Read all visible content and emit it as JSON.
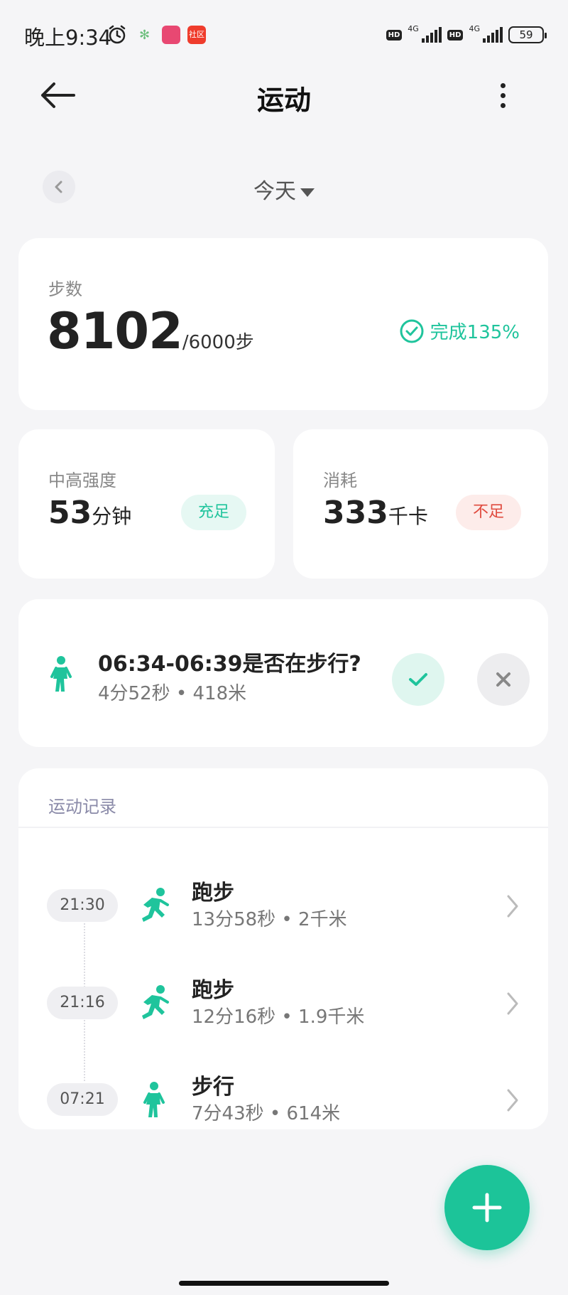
{
  "status_bar": {
    "time": "晚上9:34",
    "app3_label": "社区",
    "hd": "HD",
    "network": "4G",
    "battery": "59"
  },
  "header": {
    "title": "运动"
  },
  "date_nav": {
    "label": "今天"
  },
  "steps": {
    "label": "步数",
    "value": "8102",
    "goal": "/6000步",
    "completion": "完成135%"
  },
  "intensity": {
    "label": "中高强度",
    "value": "53",
    "unit": "分钟",
    "status": "充足"
  },
  "calories": {
    "label": "消耗",
    "value": "333",
    "unit": "千卡",
    "status": "不足"
  },
  "walk_prompt": {
    "title": "06:34-06:39是否在步行?",
    "detail": "4分52秒 • 418米"
  },
  "records": {
    "title": "运动记录",
    "items": [
      {
        "time": "21:30",
        "name": "跑步",
        "detail": "13分58秒 • 2千米",
        "icon": "running-icon"
      },
      {
        "time": "21:16",
        "name": "跑步",
        "detail": "12分16秒 • 1.9千米",
        "icon": "running-icon"
      },
      {
        "time": "07:21",
        "name": "步行",
        "detail": "7分43秒 • 614米",
        "icon": "walking-icon"
      }
    ]
  },
  "colors": {
    "accent": "#1cc499",
    "warning": "#e04b3f",
    "background": "#f5f5f7"
  }
}
